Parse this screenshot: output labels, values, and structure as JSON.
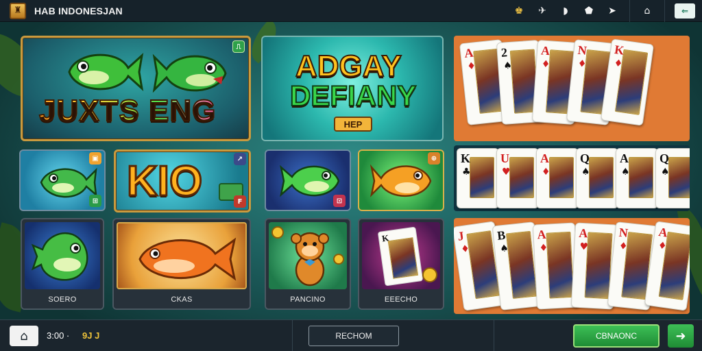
{
  "topbar": {
    "title": "HAB INDONESJAN",
    "logo_glyph": "♜",
    "icons": [
      {
        "name": "coin-bag-icon",
        "glyph": "♚"
      },
      {
        "name": "tools-icon",
        "glyph": "✈"
      },
      {
        "name": "chat-icon",
        "glyph": "◗"
      },
      {
        "name": "shield-icon",
        "glyph": "⬟"
      },
      {
        "name": "tag-icon",
        "glyph": "➤"
      },
      {
        "name": "store-icon",
        "glyph": "⌂"
      },
      {
        "name": "exit-icon",
        "glyph": "⇐"
      }
    ]
  },
  "tiles": {
    "banner_left": {
      "logo": "JUXTS ENG",
      "badge": "⎍"
    },
    "banner_center": {
      "logo_line1": "ADGAY",
      "logo_line2": "DEFIANY",
      "sub_badge": "HEP"
    },
    "kio": {
      "logo": "KIO",
      "badge_top": "↗",
      "badge_bottom": "F"
    },
    "fish_small_1": {
      "badge_top": "▣",
      "badge_bottom": "⊞"
    },
    "fish_small_2": {
      "badge_bottom": "⊡"
    },
    "fish_small_3": {
      "badge_top": "⊕"
    },
    "game_1": {
      "label": "SOERO"
    },
    "game_2": {
      "label": "CKAS"
    },
    "game_3": {
      "label": "PANCINO"
    },
    "game_4": {
      "label": "EEECHO"
    }
  },
  "card_rows": [
    [
      {
        "rank": "A",
        "suit": "♦",
        "color": "red"
      },
      {
        "rank": "2",
        "suit": "♠",
        "color": "black"
      },
      {
        "rank": "A",
        "suit": "♦",
        "color": "red"
      },
      {
        "rank": "N",
        "suit": "♦",
        "color": "red"
      },
      {
        "rank": "K",
        "suit": "♦",
        "color": "red"
      }
    ],
    [
      {
        "rank": "K",
        "suit": "♣",
        "color": "black"
      },
      {
        "rank": "U",
        "suit": "♥",
        "color": "red"
      },
      {
        "rank": "A",
        "suit": "♦",
        "color": "red"
      },
      {
        "rank": "Q",
        "suit": "♠",
        "color": "black"
      },
      {
        "rank": "A",
        "suit": "♠",
        "color": "black"
      },
      {
        "rank": "Q",
        "suit": "♠",
        "color": "black"
      }
    ],
    [
      {
        "rank": "J",
        "suit": "♦",
        "color": "red"
      },
      {
        "rank": "B",
        "suit": "♠",
        "color": "black"
      },
      {
        "rank": "A",
        "suit": "♦",
        "color": "red"
      },
      {
        "rank": "A",
        "suit": "♥",
        "color": "red"
      },
      {
        "rank": "N",
        "suit": "♦",
        "color": "red"
      },
      {
        "rank": "A",
        "suit": "♦",
        "color": "red"
      }
    ]
  ],
  "bottombar": {
    "home_glyph": "⌂",
    "clock": "3:00 ·",
    "balance": "9J J",
    "section_label": "RECHOM",
    "continue_label": "CBNAONC",
    "next_glyph": "➜"
  }
}
